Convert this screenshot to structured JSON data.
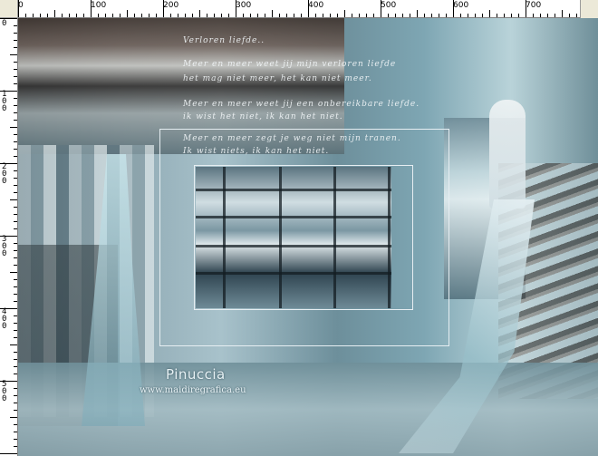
{
  "ruler": {
    "h_labels": [
      "0",
      "100",
      "200",
      "300",
      "400",
      "500",
      "600",
      "700"
    ],
    "v_labels": [
      "0",
      "100",
      "200",
      "300",
      "400",
      "500"
    ]
  },
  "poem": {
    "title": "Verloren liefde..",
    "lines": [
      "Meer en meer weet jij mijn verloren liefde",
      "het mag niet meer, het kan niet meer.",
      "Meer en meer weet jij een onbereikbare liefde.",
      "ik wist het niet, ik kan het niet.",
      "Meer en meer zegt je weg niet mijn tranen.",
      "Ik wist niets, ik kan het niet."
    ]
  },
  "watermark": {
    "name": "Pinuccia",
    "url": "www.maidiregrafica.eu"
  },
  "colors": {
    "canvas_base": "#7ea6b3",
    "frame": "#e6eef2",
    "ruler_bg": "#ffffff",
    "chrome_bg": "#ece9d8"
  }
}
